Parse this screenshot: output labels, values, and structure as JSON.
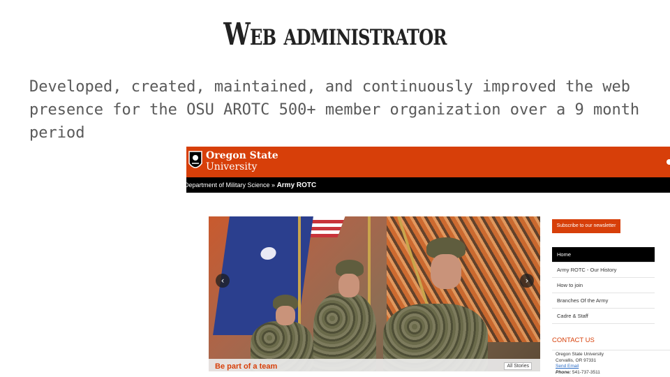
{
  "slide": {
    "title": "Web administrator",
    "body": "Developed, created, maintained, and continuously improved the web presence for the OSU AROTC 500+ member organization over a 9 month period"
  },
  "site": {
    "brand_line1": "Oregon State",
    "brand_line2": "University",
    "breadcrumb_parent": "Department of Military Science",
    "breadcrumb_sep": " » ",
    "breadcrumb_current": "Army ROTC",
    "newsletter_label": "Subscribe to our newsletter",
    "nav": [
      {
        "label": "Home",
        "active": true
      },
      {
        "label": "Army ROTC - Our History",
        "active": false
      },
      {
        "label": "How to join",
        "active": false
      },
      {
        "label": "Branches Of the Army",
        "active": false
      },
      {
        "label": "Cadre & Staff",
        "active": false
      }
    ],
    "hero": {
      "caption": "Be part of a team",
      "all_stories": "All Stories",
      "prev_icon": "chevron-left-icon",
      "next_icon": "chevron-right-icon"
    },
    "contact": {
      "heading": "CONTACT US",
      "org": "Oregon State University",
      "city": "Corvallis, OR 97331",
      "email_link": "Send Email",
      "phone_label": "Phone:",
      "phone": "541-737-3511"
    },
    "colors": {
      "brand": "#d73f09",
      "nav_active": "#000000",
      "link": "#2a6bc4"
    }
  }
}
